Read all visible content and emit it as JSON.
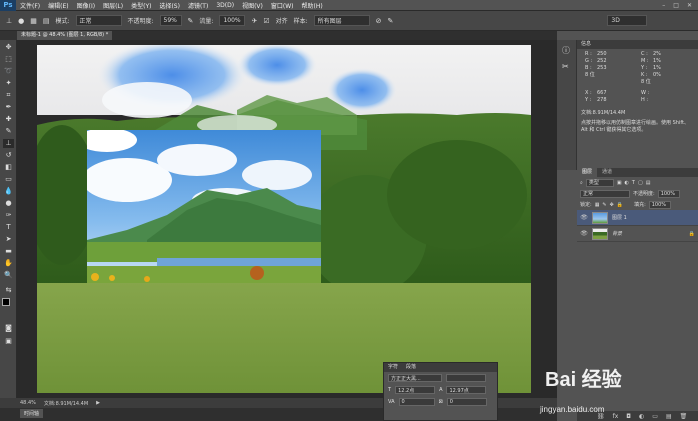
{
  "menubar": {
    "logo": "Ps",
    "items": [
      "文件(F)",
      "编辑(E)",
      "图像(I)",
      "图层(L)",
      "类型(Y)",
      "选择(S)",
      "滤镜(T)",
      "3D(D)",
      "视图(V)",
      "窗口(W)",
      "帮助(H)"
    ]
  },
  "options": {
    "mode_label": "模式:",
    "mode_value": "正常",
    "opacity_label": "不透明度:",
    "opacity_value": "59%",
    "flow_label": "流量:",
    "flow_value": "100%",
    "align_label": "对齐",
    "sample_label": "样本:",
    "sample_value": "所有图层",
    "workspace": "3D"
  },
  "document": {
    "tab_title": "未标题-1 @ 48.4% (图层 1, RGB/8) *"
  },
  "status": {
    "zoom": "48.4%",
    "doc_size": "文档:8.91M/14.4M"
  },
  "bottom_tab": "时间轴",
  "info_panel": {
    "title": "信息",
    "rgb": [
      [
        "R :",
        "250"
      ],
      [
        "G :",
        "252"
      ],
      [
        "B :",
        "253"
      ]
    ],
    "cmyk": [
      [
        "C :",
        "2%"
      ],
      [
        "M :",
        "1%"
      ],
      [
        "Y :",
        "1%"
      ],
      [
        "K :",
        "0%"
      ]
    ],
    "bits_left": "8 位",
    "bits_right": "8 位",
    "xy": [
      [
        "X :",
        "667"
      ],
      [
        "Y :",
        "278"
      ]
    ],
    "wh": [
      [
        "W :",
        ""
      ],
      [
        "H :",
        ""
      ]
    ],
    "doc": "文档:8.91M/14.4M",
    "hint": "点按并拖移以用仿制图章进行绘画。使用 Shift、Alt 和 Ctrl 键获得其它选项。"
  },
  "layers_panel": {
    "tabs": [
      "图层",
      "通道"
    ],
    "kind_label": "类型",
    "blend_mode": "正常",
    "opacity_label": "不透明度:",
    "opacity_value": "100%",
    "lock_label": "锁定:",
    "fill_label": "填充:",
    "fill_value": "100%",
    "layers": [
      {
        "name": "图层 1",
        "selected": true
      },
      {
        "name": "背景",
        "selected": false
      }
    ]
  },
  "char_panel": {
    "tabs": [
      "字符",
      "段落"
    ],
    "font": "方正正大黑...",
    "size": "12.2点",
    "leading": "12.97点",
    "tracking": "0",
    "kerning": "0"
  },
  "watermark": {
    "logo": "Bai 经验",
    "url": "jingyan.baidu.com"
  }
}
